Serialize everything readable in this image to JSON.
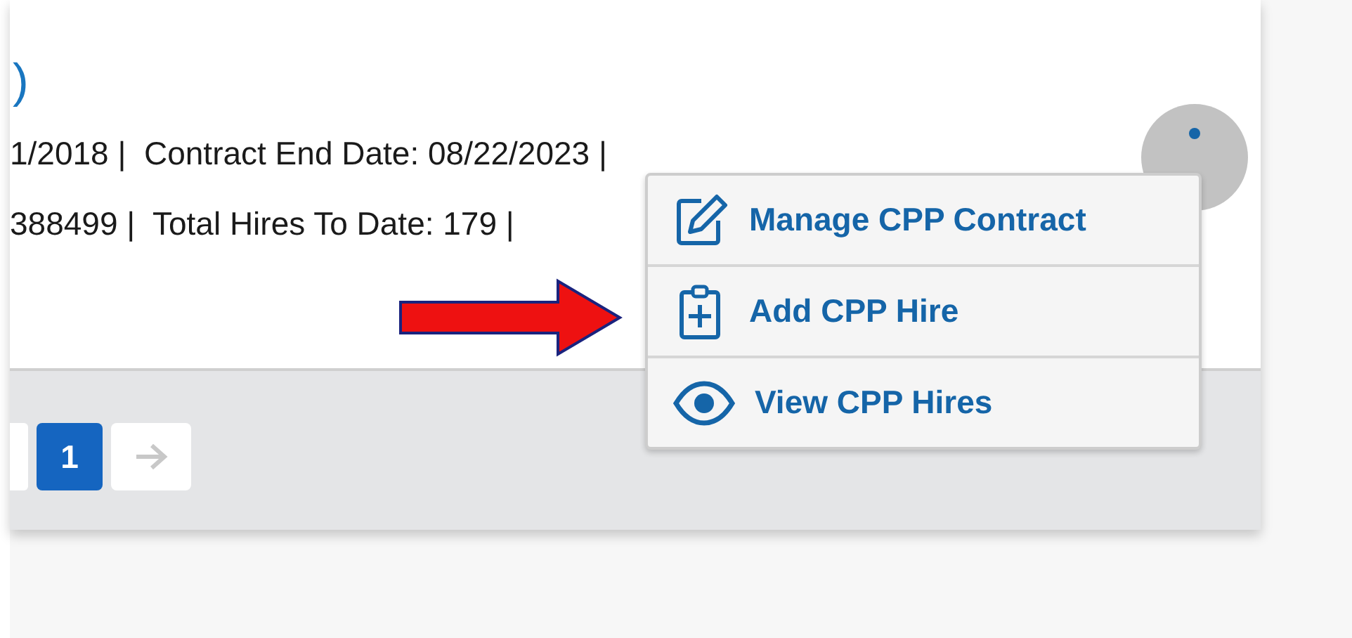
{
  "card": {
    "title_fragment": ")",
    "detail_lines": [
      "1/2018 |  Contract End Date: 08/22/2023 |",
      "388499 |  Total Hires To Date: 179 |"
    ]
  },
  "actions_menu": {
    "open": true,
    "items": [
      {
        "label": "Manage CPP Contract",
        "kind": "edit"
      },
      {
        "label": "Add CPP Hire",
        "kind": "add"
      },
      {
        "label": "View CPP Hires",
        "kind": "view"
      }
    ]
  },
  "pagination": {
    "pages": [
      {
        "label": "1",
        "selected": true
      }
    ],
    "next_disabled": true
  }
}
